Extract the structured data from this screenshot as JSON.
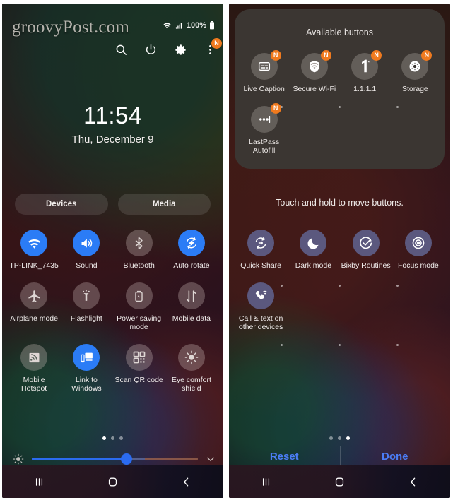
{
  "left_panel": {
    "watermark": "groovyPost.com",
    "status_bar": {
      "battery_percent": "100%",
      "wifi_icon": "wifi-icon",
      "signal_icon": "cellular-signal-icon",
      "battery_icon": "battery-full-icon"
    },
    "top_icons": [
      {
        "name": "search-icon",
        "label": "Search"
      },
      {
        "name": "power-icon",
        "label": "Power"
      },
      {
        "name": "gear-icon",
        "label": "Settings"
      },
      {
        "name": "overflow-menu-icon",
        "label": "More options",
        "badge": "N"
      }
    ],
    "clock": "11:54",
    "date": "Thu, December 9",
    "chips": [
      {
        "label": "Devices",
        "name": "devices-chip"
      },
      {
        "label": "Media",
        "name": "media-chip"
      }
    ],
    "quick_settings": [
      {
        "label": "TP-LINK_7435",
        "icon": "wifi-icon",
        "active": true
      },
      {
        "label": "Sound",
        "icon": "speaker-icon",
        "active": true
      },
      {
        "label": "Bluetooth",
        "icon": "bluetooth-icon",
        "active": false
      },
      {
        "label": "Auto rotate",
        "icon": "auto-rotate-icon",
        "active": true
      },
      {
        "label": "Airplane mode",
        "icon": "airplane-icon",
        "active": false
      },
      {
        "label": "Flashlight",
        "icon": "flashlight-icon",
        "active": false
      },
      {
        "label": "Power saving mode",
        "icon": "battery-saver-icon",
        "active": false
      },
      {
        "label": "Mobile data",
        "icon": "mobile-data-icon",
        "active": false
      },
      {
        "label": "Mobile Hotspot",
        "icon": "hotspot-icon",
        "active": false
      },
      {
        "label": "Link to Windows",
        "icon": "link-to-windows-icon",
        "active": true
      },
      {
        "label": "Scan QR code",
        "icon": "qr-code-icon",
        "active": false
      },
      {
        "label": "Eye comfort shield",
        "icon": "eye-comfort-icon",
        "active": false
      }
    ],
    "page_dots": {
      "count": 3,
      "active_index": 0
    },
    "brightness": {
      "percent": 57,
      "sun_icon": "brightness-icon",
      "expand_icon": "chevron-down-icon"
    }
  },
  "right_panel": {
    "available_title": "Available buttons",
    "available_buttons": [
      {
        "label": "Live Caption",
        "icon": "live-caption-icon",
        "badge": "N"
      },
      {
        "label": "Secure Wi-Fi",
        "icon": "secure-wifi-icon",
        "badge": "N"
      },
      {
        "label": "1.1.1.1",
        "icon": "one-one-one-one-icon",
        "badge": "N"
      },
      {
        "label": "Storage",
        "icon": "storage-icon",
        "badge": "N"
      },
      {
        "label": "LastPass Autofill",
        "icon": "lastpass-icon",
        "badge": "N"
      }
    ],
    "hint": "Touch and hold to move buttons.",
    "active_buttons": [
      {
        "label": "Quick Share",
        "icon": "quick-share-icon"
      },
      {
        "label": "Dark mode",
        "icon": "moon-icon"
      },
      {
        "label": "Bixby Routines",
        "icon": "bixby-routines-icon"
      },
      {
        "label": "Focus mode",
        "icon": "focus-mode-icon"
      },
      {
        "label": "Call & text on other devices",
        "icon": "call-text-other-devices-icon"
      }
    ],
    "page_dots": {
      "count": 3,
      "active_index": 2
    },
    "actions": [
      {
        "label": "Reset",
        "name": "reset-button"
      },
      {
        "label": "Done",
        "name": "done-button"
      }
    ]
  },
  "nav_bar": {
    "recents": "recents-icon",
    "home": "home-icon",
    "back": "back-icon"
  },
  "colors": {
    "accent_blue": "#2b7cf6",
    "action_blue": "#4b7df5",
    "badge_orange": "#f07a1e",
    "tile_violet": "#5b587e",
    "panel_gray": "#3b3632"
  }
}
